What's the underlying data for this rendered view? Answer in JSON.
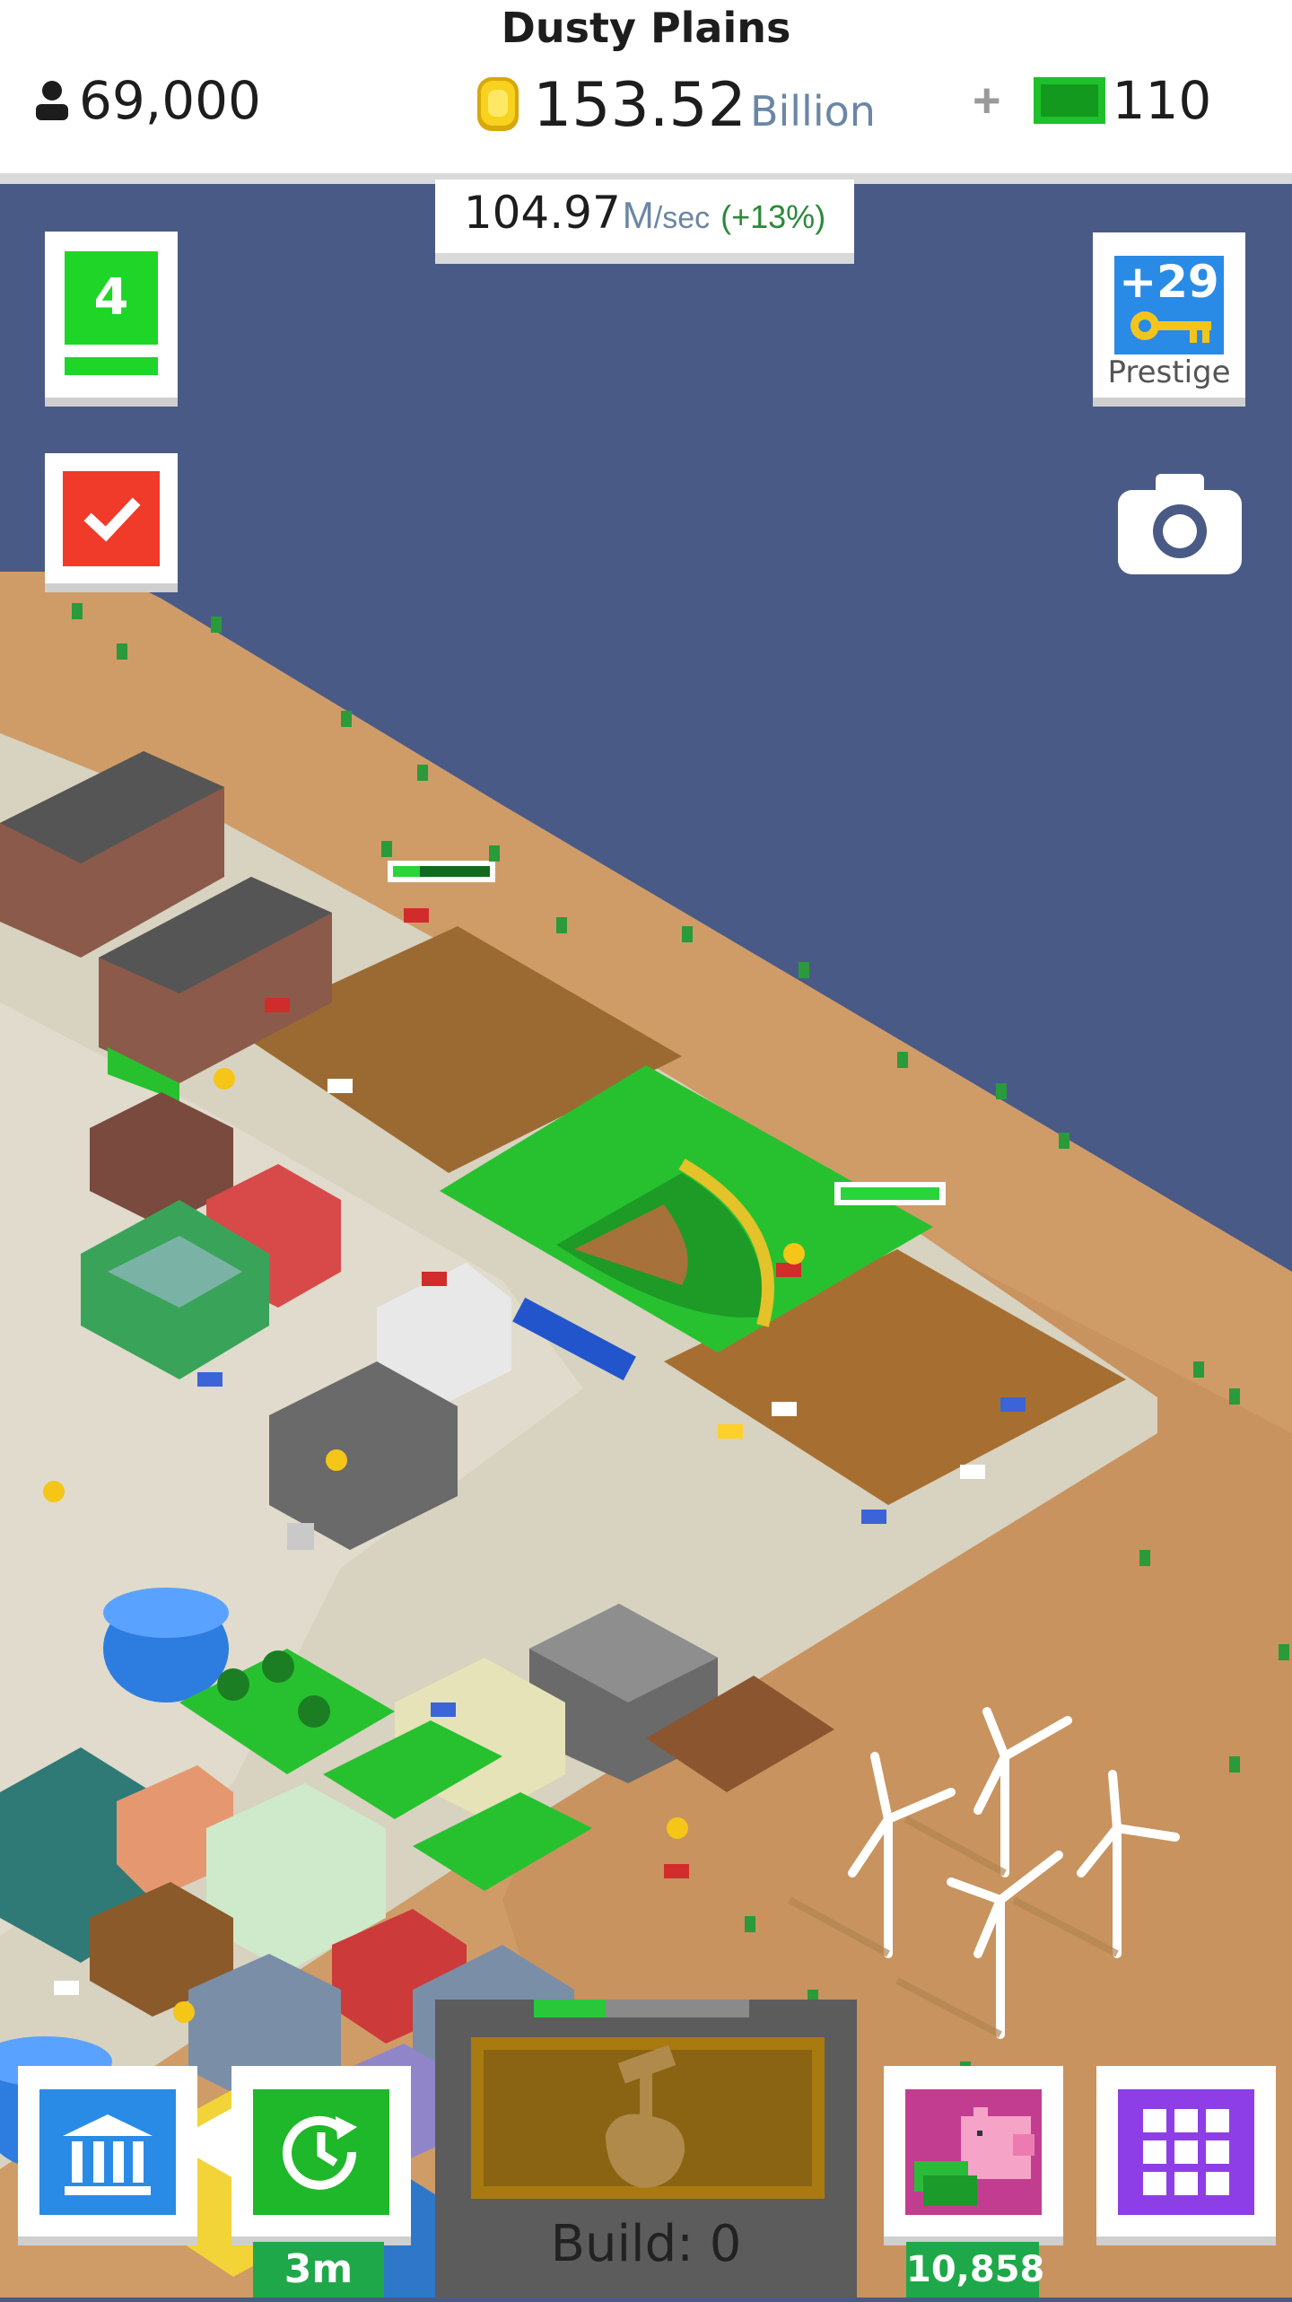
{
  "header": {
    "city_name": "Dusty Plains",
    "population": "69,000",
    "money_value": "153.52",
    "money_unit": "Billion",
    "cash": "110",
    "income_value": "104.97",
    "income_unit": "M",
    "income_per": "/sec",
    "income_bonus": "(+13%)"
  },
  "side_buttons": {
    "level": "4",
    "prestige_keys": "+29",
    "prestige_label": "Prestige"
  },
  "bottom_bar": {
    "timer_label": "3m",
    "piggy_bank_label": "10,858",
    "build_label": "Build: 0"
  },
  "colors": {
    "water": "#4a5a86",
    "sand": "#cf9c68",
    "dirt": "#9b6a33",
    "grass": "#27c12f",
    "road": "#d8d2c0",
    "accent_green": "#1ed528",
    "task_red": "#f03a2a",
    "bank_blue": "#2a8be6",
    "grid_purple": "#8e3ee6",
    "piggy_pink": "#c23d8f"
  }
}
